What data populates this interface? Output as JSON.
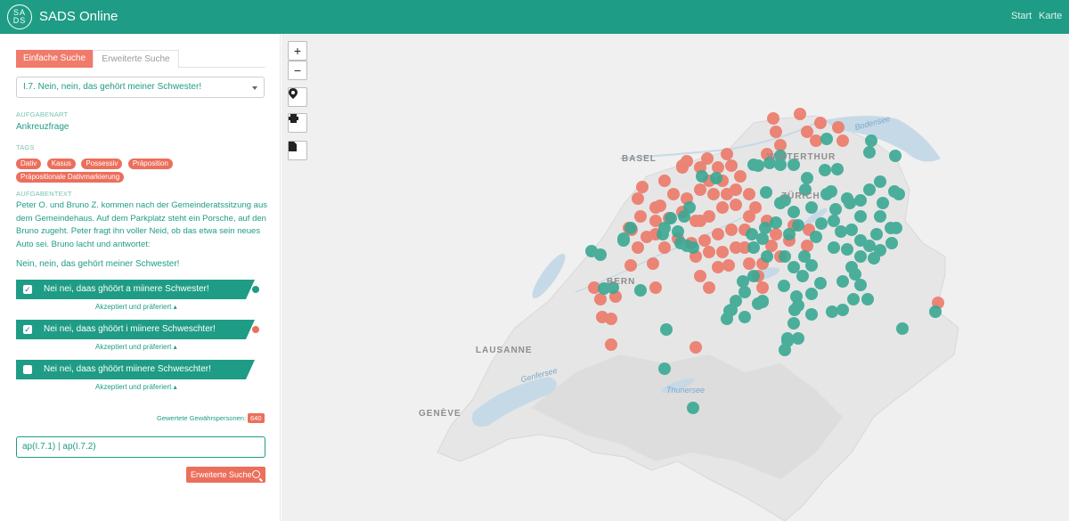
{
  "header": {
    "logo_top": "SA",
    "logo_bottom": "DS",
    "title": "SADS Online",
    "nav": [
      "Start",
      "Karte"
    ]
  },
  "sidebar": {
    "tabs": [
      "Einfache Suche",
      "Erweiterte Suche"
    ],
    "selected_question": "I.7. Nein, nein, das gehört meiner Schwester!",
    "aufgabenart_label": "AUFGABENART",
    "aufgabenart": "Ankreuzfrage",
    "tags_label": "TAGS",
    "tags": [
      "Dativ",
      "Kasus",
      "Possessiv",
      "Präposition",
      "Präpositionale Dativmarkierung"
    ],
    "aufgabentext_label": "AUFGABENTEXT",
    "aufgabentext": "Peter O. und Bruno Z. kommen nach der Gemeinderatssitzung aus dem Gemeindehaus. Auf dem Parkplatz steht ein Porsche, auf den Bruno zugeht. Peter fragt ihn voller Neid, ob das etwa sein neues Auto sei. Bruno lacht und antwortet:",
    "prompt": "Nein, nein, das gehört meiner Schwester!",
    "answers": [
      {
        "text": "Nei nei, daas ghöört a miinere Schwester!",
        "checked": true,
        "dot_color": "#1f9c85",
        "sub": "Akzeptiert und präferiert"
      },
      {
        "text": "Nei nei, daas ghöört i miinere Schweschter!",
        "checked": true,
        "dot_color": "#ec6f5c",
        "sub": "Akzeptiert und präferiert"
      },
      {
        "text": "Nei nei, daas ghöört miinere Schweschter!",
        "checked": false,
        "dot_color": "",
        "sub": "Akzeptiert und präferiert"
      }
    ],
    "count_label": "Gewertete Gewährspersonen:",
    "count": "640",
    "query": "ap(I.7.1) | ap(I.7.2)",
    "search_button": "Erweiterte Suche"
  },
  "map": {
    "controls": [
      "+",
      "−",
      "location-icon",
      "print-icon",
      "document-icon"
    ],
    "cities": [
      "BASEL",
      "WINTERTHUR",
      "ZÜRICH",
      "BERN",
      "LAUSANNE",
      "GENÈVE"
    ],
    "lakes": [
      "Bodensee",
      "Genfersee",
      "Thunersee"
    ],
    "colors": {
      "teal": "#3aa893",
      "salmon": "#ec7a69"
    }
  }
}
